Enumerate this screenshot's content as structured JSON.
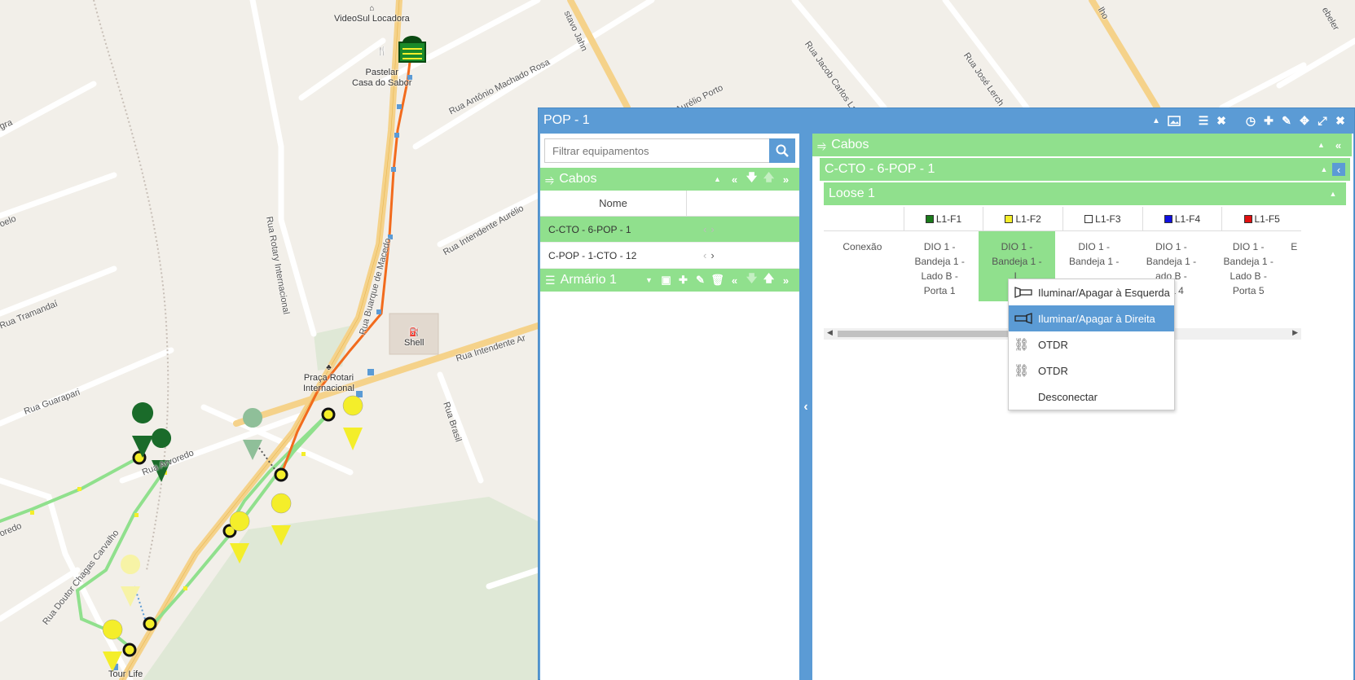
{
  "map": {
    "street_labels": [
      "Rua Antônio Machado Rosa",
      "Rua Jacob Carlos La",
      "Rua José Lerch",
      "Rua Rotary Internacional",
      "Rua Intendente Aurélio",
      "Rua Tramandaí",
      "Rua Guarapari",
      "Rua Buarque de Macedo",
      "Rua Intendente Ar",
      "Rua Brasil",
      "Rua Arvoredo",
      "Rua Doutor Chagas Carvalho",
      "Aurélio Porto",
      "stavo Jahn",
      "gra",
      "oelo",
      "oredo",
      "lho",
      "ebeler"
    ],
    "poi": {
      "videosul": "VideoSul Locadora",
      "pastelaria": "Pastelar\nCasa do Sabor",
      "shell": "Shell",
      "praca": "Praça Rotari\nInternacional",
      "tour": "Tour Life"
    }
  },
  "window": {
    "title": "POP - 1",
    "icons": [
      "collapse-icon",
      "image-icon",
      "list-icon",
      "close-x-icon",
      "history-icon",
      "add-icon",
      "edit-icon",
      "locate-icon",
      "expand-icon",
      "close-icon"
    ]
  },
  "left": {
    "search_placeholder": "Filtrar equipamentos",
    "cabos_label": "Cabos",
    "col_nome": "Nome",
    "rows": [
      "C-CTO - 6-POP - 1",
      "C-POP - 1-CTO - 12"
    ],
    "armario_label": "Armário 1"
  },
  "right": {
    "cabos_label": "Cabos",
    "cable_label": "C-CTO - 6-POP - 1",
    "loose_label": "Loose 1",
    "fibers": [
      {
        "label": "L1-F1",
        "color": "#1a7a1a"
      },
      {
        "label": "L1-F2",
        "color": "#f4ee2a"
      },
      {
        "label": "L1-F3",
        "color": "#ffffff"
      },
      {
        "label": "L1-F4",
        "color": "#1010e0"
      },
      {
        "label": "L1-F5",
        "color": "#e01010"
      }
    ],
    "conexao_label": "Conexão",
    "cells": [
      "DIO 1 -\nBandeja 1 -\nLado B -\nPorta 1",
      "DIO 1 -\nBandeja 1 -\nL",
      "DIO 1 -\nBandeja 1 -\n",
      "DIO 1 -\nBandeja 1 -\nado B -\norta 4",
      "DIO 1 -\nBandeja 1 -\nLado B -\nPorta 5"
    ],
    "partial_cell": "E"
  },
  "context_menu": {
    "items": [
      {
        "label": "Iluminar/Apagar à Esquerda",
        "icon": "flashlight-left-icon"
      },
      {
        "label": "Iluminar/Apagar à Direita",
        "icon": "flashlight-right-icon"
      },
      {
        "label": "OTDR",
        "icon": "otdr-link-icon"
      },
      {
        "label": "OTDR",
        "icon": "otdr-unlink-icon"
      },
      {
        "label": "Desconectar",
        "icon": ""
      }
    ]
  },
  "colors": {
    "accent_blue": "#5b9bd5",
    "green_bar": "#90e08d",
    "route_orange": "#f26b1d",
    "route_green": "#90e08d"
  }
}
